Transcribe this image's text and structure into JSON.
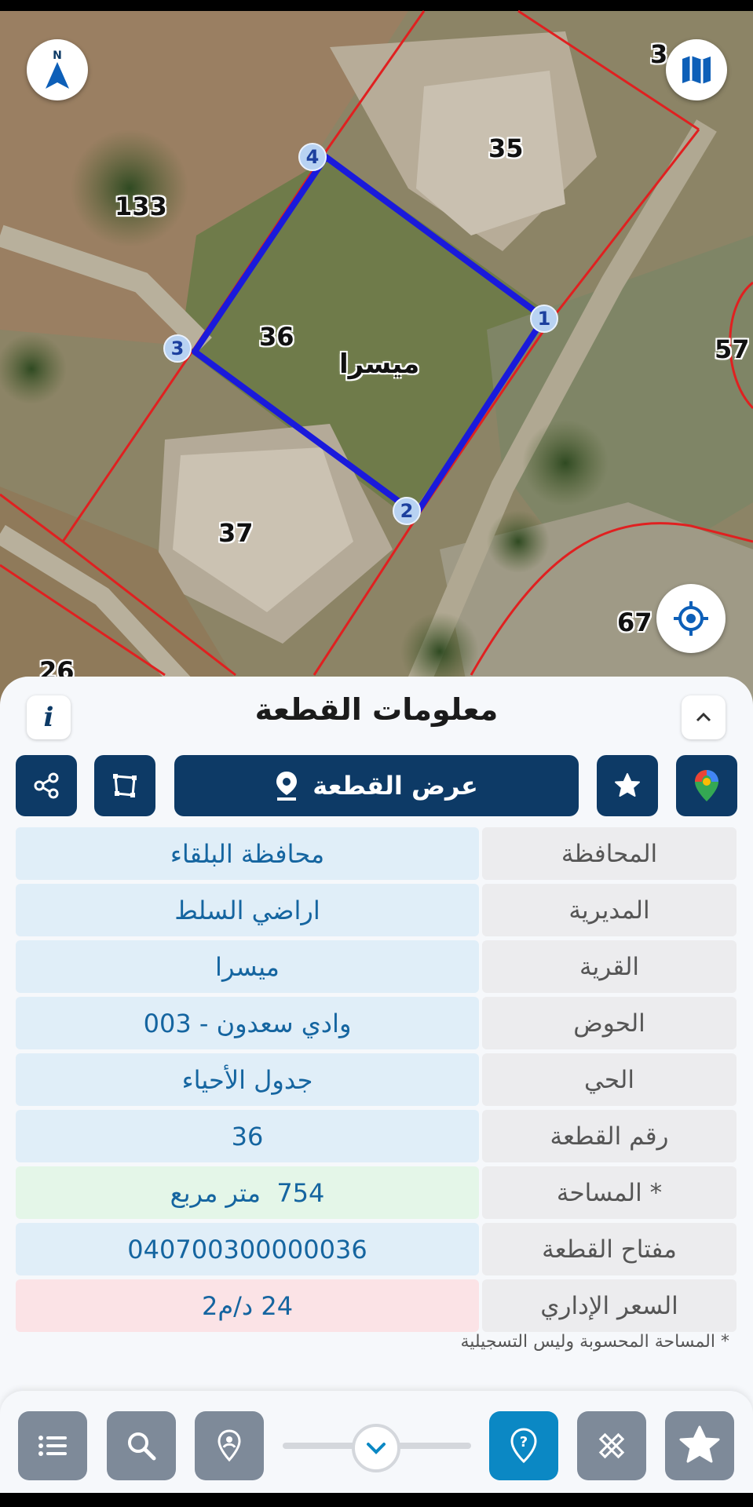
{
  "map": {
    "parcel_numbers": [
      "35",
      "133",
      "36",
      "57",
      "37",
      "67",
      "26",
      "3"
    ],
    "village_label": "ميسرا",
    "vertices": [
      "1",
      "2",
      "3",
      "4"
    ],
    "north_icon": "north-arrow-icon",
    "map_type_icon": "map-icon",
    "locate_icon": "crosshair-icon",
    "plot_outline_color": "#1a1adb",
    "boundary_color": "#e02020"
  },
  "sheet": {
    "title": "معلومات القطعة",
    "view_plot_label": "عرض القطعة",
    "info_icon": "i"
  },
  "rows": [
    {
      "label": "المحافظة",
      "value": "محافظة البلقاء"
    },
    {
      "label": "المديرية",
      "value": "اراضي السلط"
    },
    {
      "label": "القرية",
      "value": "ميسرا"
    },
    {
      "label": "الحوض",
      "value": "وادي سعدون - 003"
    },
    {
      "label": "الحي",
      "value": "جدول الأحياء"
    },
    {
      "label": "رقم القطعة",
      "value": "36"
    },
    {
      "label": "المساحة *",
      "value": "754  متر مربع"
    },
    {
      "label": "مفتاح القطعة",
      "value": "040700300000036"
    },
    {
      "label": "السعر الإداري",
      "value": "24 د/م2"
    }
  ],
  "footnote": "* المساحة المحسوبة وليس التسجيلية",
  "colors": {
    "primary_dark": "#0d3a66",
    "accent_blue": "#0b88c4",
    "value_text": "#1565a0",
    "toolbar_grey": "#7e8a99"
  }
}
